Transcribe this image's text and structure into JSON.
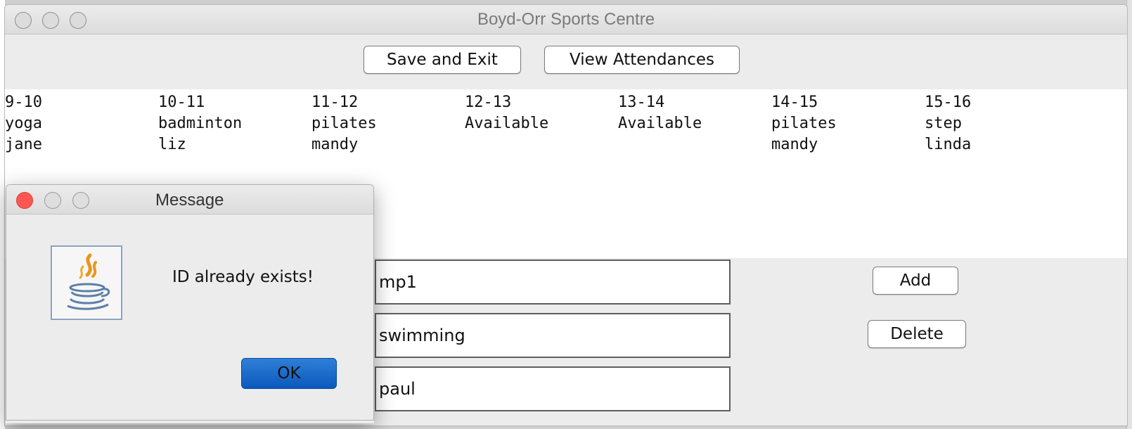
{
  "window": {
    "title": "Boyd-Orr Sports Centre"
  },
  "toolbar": {
    "save_exit_label": "Save and Exit",
    "view_attendances_label": "View Attendances"
  },
  "schedule": {
    "slots": [
      {
        "time": "9-10",
        "activity": "yoga",
        "instructor": "jane"
      },
      {
        "time": "10-11",
        "activity": "badminton",
        "instructor": "liz"
      },
      {
        "time": "11-12",
        "activity": "pilates",
        "instructor": "mandy"
      },
      {
        "time": "12-13",
        "activity": "Available",
        "instructor": ""
      },
      {
        "time": "13-14",
        "activity": "Available",
        "instructor": ""
      },
      {
        "time": "14-15",
        "activity": "pilates",
        "instructor": "mandy"
      },
      {
        "time": "15-16",
        "activity": "step",
        "instructor": "linda"
      }
    ]
  },
  "form": {
    "id_value": "mp1",
    "class_value": "swimming",
    "instructor_value": "paul",
    "add_label": "Add",
    "delete_label": "Delete"
  },
  "dialog": {
    "title": "Message",
    "message": "ID already exists!",
    "ok_label": "OK",
    "icon": "java-coffee-cup-icon"
  },
  "colors": {
    "close_button": "#fc5753",
    "ok_button": "#0a59bd",
    "window_bg": "#ececec"
  }
}
